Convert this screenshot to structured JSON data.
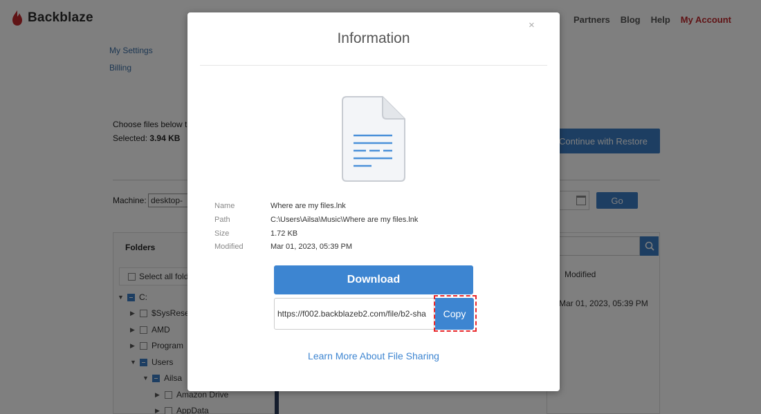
{
  "brand": {
    "name": "Backblaze",
    "color": "#c0282d"
  },
  "nav": {
    "items": [
      "Partners",
      "Blog",
      "Help"
    ],
    "account": "My Account"
  },
  "side_links": [
    "My Settings",
    "Billing"
  ],
  "restore": {
    "instructions": "Choose files below t",
    "selected_label": "Selected:",
    "selected_size": "3.94 KB",
    "continue_label": "Continue with Restore"
  },
  "machine": {
    "label": "Machine:",
    "value": "desktop-"
  },
  "go_label": "Go",
  "folders": {
    "title": "Folders",
    "select_all": "Select all fold",
    "tree": [
      "C:",
      "$SysRese",
      "AMD",
      "Program",
      "Users",
      "Ailsa",
      "Amazon Drive",
      "AppData"
    ]
  },
  "file_list": {
    "modified_header": "Modified",
    "modified_value": "Mar 01, 2023, 05:39 PM"
  },
  "modal": {
    "title": "Information",
    "close_glyph": "×",
    "fields": [
      {
        "label": "Name",
        "value": "Where are my files.lnk"
      },
      {
        "label": "Path",
        "value": "C:\\Users\\Ailsa\\Music\\Where are my files.lnk"
      },
      {
        "label": "Size",
        "value": "1.72 KB"
      },
      {
        "label": "Modified",
        "value": "Mar 01, 2023, 05:39 PM"
      }
    ],
    "download_label": "Download",
    "share_url": "https://f002.backblazeb2.com/file/b2-sha",
    "copy_label": "Copy",
    "learn_more": "Learn More About File Sharing"
  },
  "colors": {
    "accent": "#3d85d1",
    "highlight": "#e8272b"
  }
}
